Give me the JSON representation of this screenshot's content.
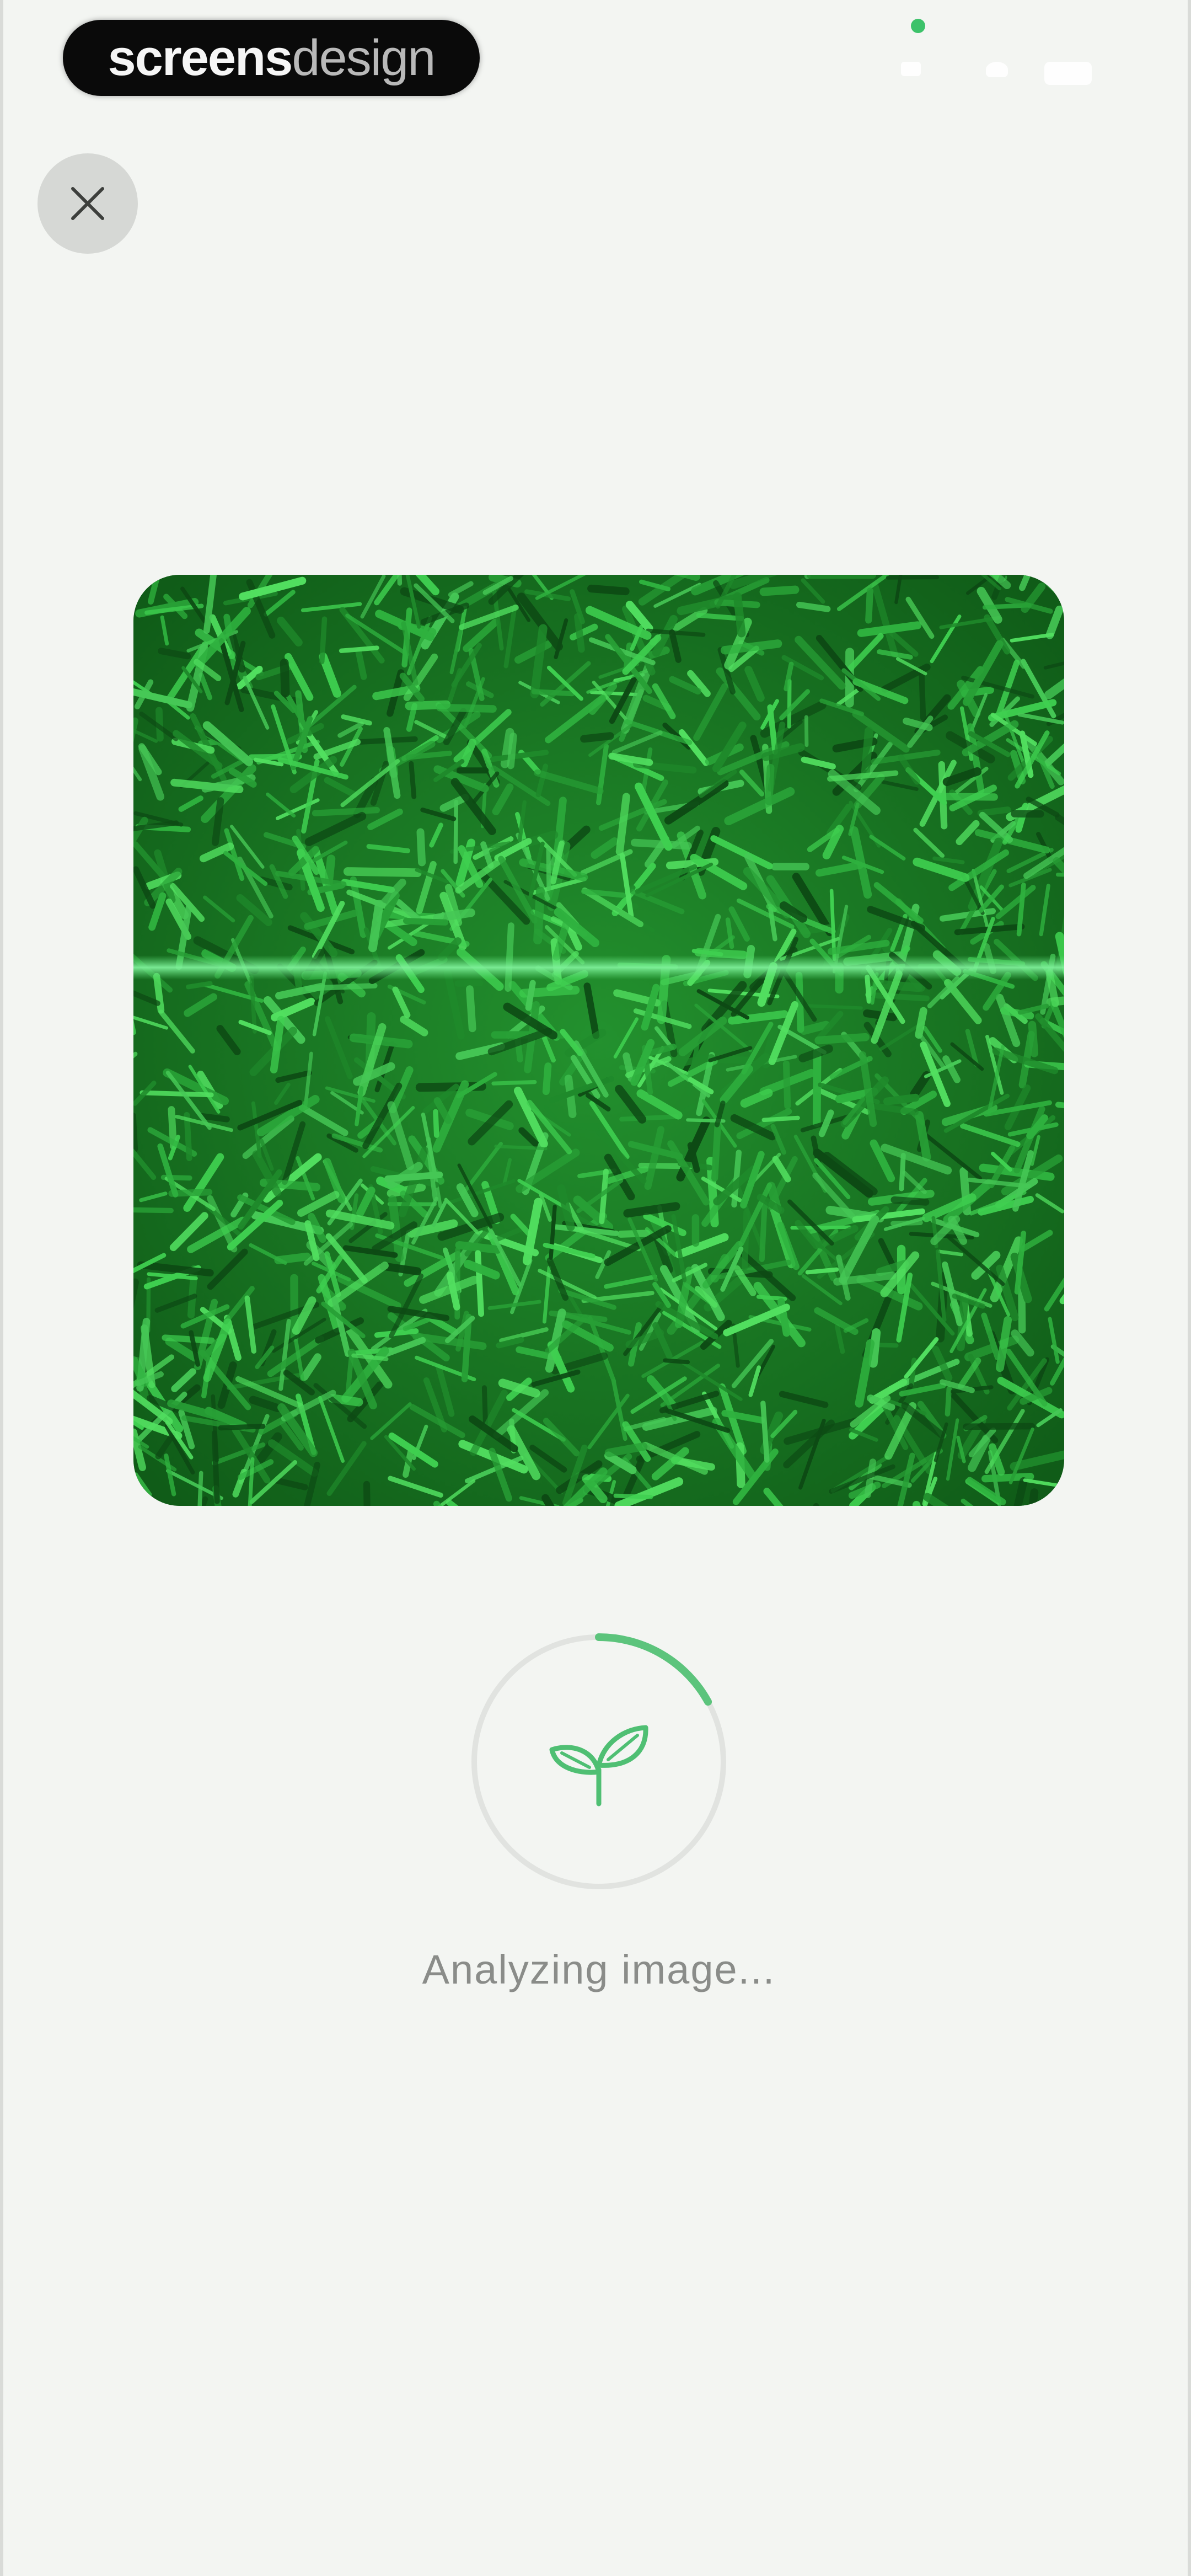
{
  "brand": {
    "strong": "screens",
    "light": "design"
  },
  "status_bar": {
    "icons": [
      "signal-icon",
      "wifi-icon",
      "battery-icon"
    ],
    "dot_color": "#3cc26a"
  },
  "close_button": {
    "icon": "close-icon"
  },
  "scan": {
    "image_subject": "grass",
    "scan_line_color": "#5fe07a"
  },
  "progress": {
    "value": 0.17,
    "track_color": "#e1e3e0",
    "accent_color": "#5cc47c",
    "icon": "sprout-icon"
  },
  "status": {
    "text": "Analyzing image..."
  }
}
